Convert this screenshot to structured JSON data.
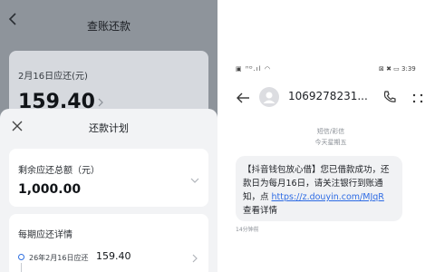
{
  "left": {
    "header": {
      "title": "查账还款"
    },
    "card": {
      "label": "2月16日应还(元)",
      "amount": "159.40"
    },
    "sheet": {
      "title": "还款计划",
      "remaining_label": "剩余应还总额（元）",
      "remaining_value": "1,000.00",
      "installments_label": "每期应还详情",
      "installment": {
        "date": "26年2月16日应还",
        "amount": "159.40"
      }
    }
  },
  "right": {
    "status_bar": {
      "left": "▣ ᴴᴰ.ıl ◠",
      "right": "⊠ ✖ ▭ 3:39"
    },
    "header": {
      "number": "1069278231..."
    },
    "category": "短信/彩信",
    "day": "今天星期五",
    "message": {
      "text_1": "【抖音钱包放心借】您已借款成功，还款日为每月16日，请关注银行到账通知，点 ",
      "link": "https://z.douyin.com/MJqR",
      "text_2": " 查看详情"
    },
    "time": "14分钟前"
  },
  "colors": {
    "accent": "#2d6be4",
    "dim_overlay": "#8e949b",
    "sheet_bg": "#f2f3f5",
    "bubble_bg": "#f1f2f4"
  }
}
